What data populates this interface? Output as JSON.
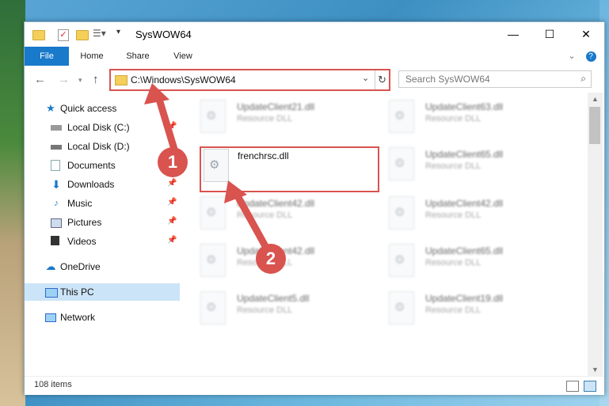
{
  "window": {
    "title": "SysWOW64"
  },
  "ribbon": {
    "tabs": [
      "File",
      "Home",
      "Share",
      "View"
    ]
  },
  "address": {
    "path": "C:\\Windows\\SysWOW64"
  },
  "search": {
    "placeholder": "Search SysWOW64"
  },
  "sidebar": {
    "items": [
      {
        "label": "Quick access"
      },
      {
        "label": "Local Disk (C:)"
      },
      {
        "label": "Local Disk (D:)"
      },
      {
        "label": "Documents"
      },
      {
        "label": "Downloads"
      },
      {
        "label": "Music"
      },
      {
        "label": "Pictures"
      },
      {
        "label": "Videos"
      },
      {
        "label": "OneDrive"
      },
      {
        "label": "This PC"
      },
      {
        "label": "Network"
      }
    ]
  },
  "files": [
    {
      "name": "UpdateClient21.dll",
      "type": "Resource DLL"
    },
    {
      "name": "UpdateClient63.dll",
      "type": "Resource DLL"
    },
    {
      "name": "frenchrsc.dll",
      "type": ""
    },
    {
      "name": "UpdateClient65.dll",
      "type": "Resource DLL"
    },
    {
      "name": "UpdateClient42.dll",
      "type": "Resource DLL"
    },
    {
      "name": "UpdateClient42.dll",
      "type": "Resource DLL"
    },
    {
      "name": "UpdateClient42.dll",
      "type": "Resource DLL"
    },
    {
      "name": "UpdateClient65.dll",
      "type": "Resource DLL"
    },
    {
      "name": "UpdateClient5.dll",
      "type": "Resource DLL"
    },
    {
      "name": "UpdateClient19.dll",
      "type": "Resource DLL"
    }
  ],
  "status": {
    "count": "108 items"
  },
  "markers": {
    "one": "1",
    "two": "2"
  },
  "colors": {
    "accent": "#1979ca",
    "highlight": "#d9534f",
    "selected": "#cce4f7"
  }
}
